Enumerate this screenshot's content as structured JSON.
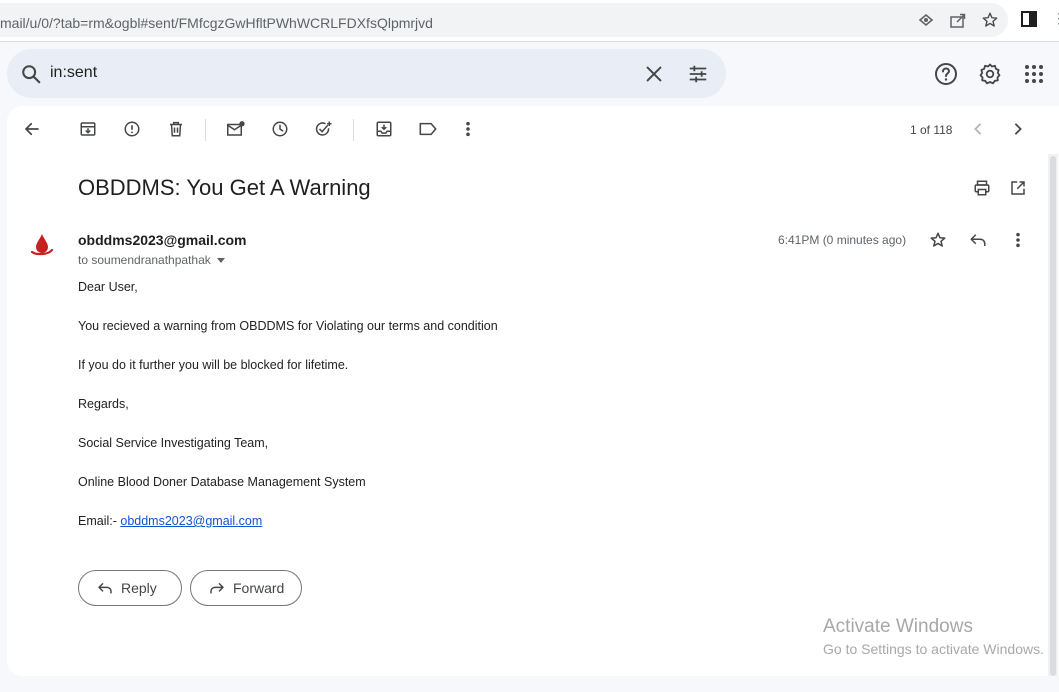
{
  "browser": {
    "url": "mail/u/0/?tab=rm&ogbl#sent/FMfcgzGwHfltPWhWCRLFDXfsQlpmrjvd"
  },
  "search": {
    "value": "in:sent"
  },
  "pager": {
    "text": "1 of 118"
  },
  "message": {
    "subject": "OBDDMS: You Get A Warning",
    "sender": "obddms2023@gmail.com",
    "recipient": "to soumendranathpathak",
    "time": "6:41PM (0 minutes ago)",
    "body": {
      "greeting": "Dear User,",
      "line1": "You recieved a warning from OBDDMS for Violating our terms and condition",
      "line2": "If you do it further you will be blocked for lifetime.",
      "regards": "Regards,",
      "team": "Social Service Investigating Team,",
      "org": "Online Blood Doner Database Management System",
      "email_label": "Email:- ",
      "email_link": "obddms2023@gmail.com"
    }
  },
  "actions": {
    "reply_label": "Reply",
    "forward_label": "Forward"
  },
  "watermark": {
    "line1": "Activate Windows",
    "line2": "Go to Settings to activate Windows."
  },
  "colors": {
    "accent_link": "#1155cc",
    "avatar_red": "#c5221f",
    "search_bg": "#e9eef6"
  }
}
